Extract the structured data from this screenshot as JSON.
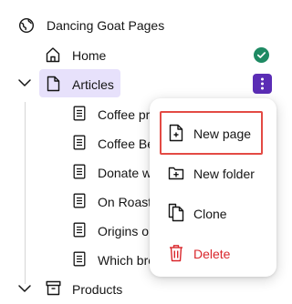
{
  "tree": {
    "root": {
      "label": "Dancing Goat Pages",
      "icon": "globe-icon"
    },
    "home": {
      "label": "Home",
      "icon": "home-icon",
      "status_color": "#1e8a63"
    },
    "articles": {
      "label": "Articles",
      "icon": "page-icon",
      "expanded": true,
      "selected": true,
      "children": [
        {
          "label": "Coffee pr",
          "icon": "document-icon"
        },
        {
          "label": "Coffee Be",
          "icon": "document-icon"
        },
        {
          "label": "Donate w",
          "icon": "document-icon"
        },
        {
          "label": "On Roast",
          "icon": "document-icon"
        },
        {
          "label": "Origins o",
          "icon": "document-icon"
        },
        {
          "label": "Which bre",
          "icon": "document-icon"
        }
      ]
    },
    "products": {
      "label": "Products",
      "icon": "archive-icon",
      "expanded": true
    }
  },
  "context_menu": {
    "items": [
      {
        "label": "New page",
        "icon": "new-page-icon",
        "highlighted": true
      },
      {
        "label": "New folder",
        "icon": "new-folder-icon"
      },
      {
        "label": "Clone",
        "icon": "clone-icon"
      },
      {
        "label": "Delete",
        "icon": "trash-icon",
        "color": "#d9262b"
      }
    ]
  },
  "colors": {
    "accent": "#5b2db5",
    "selection": "#e7e1fb",
    "published": "#1e8a63",
    "danger": "#d9262b",
    "highlight_outline": "#e34a44"
  }
}
